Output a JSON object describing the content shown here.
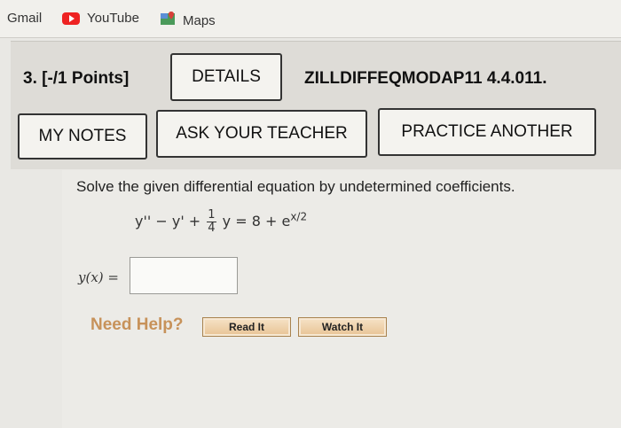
{
  "bookmarks": [
    {
      "label": "Gmail",
      "icon": "none"
    },
    {
      "label": "YouTube",
      "icon": "youtube-icon"
    },
    {
      "label": "Maps",
      "icon": "maps-icon"
    }
  ],
  "question": {
    "number": "3. [-/1 Points]",
    "details_label": "DETAILS",
    "code": "ZILLDIFFEQMODAP11 4.4.011.",
    "my_notes_label": "MY NOTES",
    "ask_teacher_label": "ASK YOUR TEACHER",
    "practice_label": "PRACTICE ANOTHER",
    "prompt": "Solve the given differential equation by undetermined coefficients.",
    "equation": {
      "left": "y'' − y' +",
      "frac_num": "1",
      "frac_den": "4",
      "right": "y = 8 + e",
      "exponent": "x/2"
    },
    "answer_label": "y(x) =",
    "answer_value": "",
    "need_help": "Need Help?",
    "read_it": "Read It",
    "watch_it": "Watch It"
  },
  "colors": {
    "background": "#e9e8e4",
    "need_help": "#c7925a",
    "help_button": "#e8c394"
  }
}
